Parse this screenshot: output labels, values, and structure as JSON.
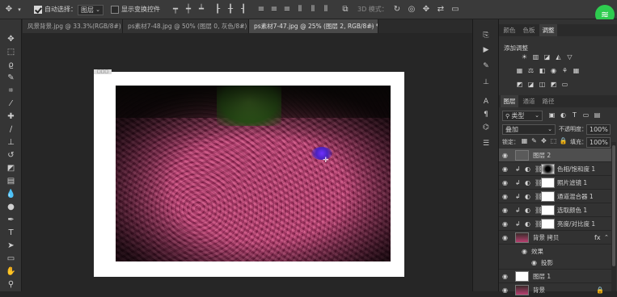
{
  "options_bar": {
    "move_tool_icon": "move-icon",
    "auto_select_checked": true,
    "auto_select_label": "自动选择：",
    "auto_select_target": "图层",
    "show_transform_checked": false,
    "show_transform_label": "显示变换控件",
    "mode_3d_label": "3D 模式："
  },
  "tabs": [
    {
      "label": "风景背景.jpg @ 33.3%(RGB/8#)",
      "active": false
    },
    {
      "label": "ps素材7-48.jpg @ 50% (图层 0, 灰色/8#) *",
      "active": false
    },
    {
      "label": "ps素材7-47.jpg @ 25% (图层 2, RGB/8#) *",
      "active": true
    }
  ],
  "panels": {
    "top_tabs": [
      "颜色",
      "色板",
      "调整"
    ],
    "active_top_tab": "调整",
    "adjust_title": "添加调整",
    "layer_tabs": [
      "图层",
      "通道",
      "路径"
    ],
    "active_layer_tab": "图层",
    "filter_kind": "类型",
    "blend_mode": "叠加",
    "opacity_label": "不透明度：",
    "opacity_value": "100%",
    "lock_label": "锁定：",
    "fill_label": "填充：",
    "fill_value": "100%"
  },
  "layers": [
    {
      "name": "图层 2",
      "selected": true,
      "adjust_icon": ""
    },
    {
      "name": "色相/饱和度 1",
      "selected": false,
      "adjust_icon": "hue-saturation-icon"
    },
    {
      "name": "照片滤镜 1",
      "selected": false,
      "adjust_icon": "photo-filter-icon"
    },
    {
      "name": "通道混合器 1",
      "selected": false,
      "adjust_icon": "channel-mixer-icon"
    },
    {
      "name": "选取颜色 1",
      "selected": false,
      "adjust_icon": "selective-color-icon"
    },
    {
      "name": "亮度/对比度 1",
      "selected": false,
      "adjust_icon": "brightness-contrast-icon"
    },
    {
      "name": "背景 拷贝",
      "selected": false,
      "adjust_icon": ""
    },
    {
      "name": "效果",
      "selected": false,
      "adjust_icon": ""
    },
    {
      "name": "投影",
      "selected": false,
      "adjust_icon": ""
    },
    {
      "name": "图层 1",
      "selected": false,
      "adjust_icon": ""
    },
    {
      "name": "背景",
      "selected": false,
      "adjust_icon": ""
    }
  ],
  "colors": {
    "foreground": "#000000",
    "background": "#ffffff",
    "brush_spot": "#5a2ae0",
    "wifi": "#2ecc4f"
  }
}
